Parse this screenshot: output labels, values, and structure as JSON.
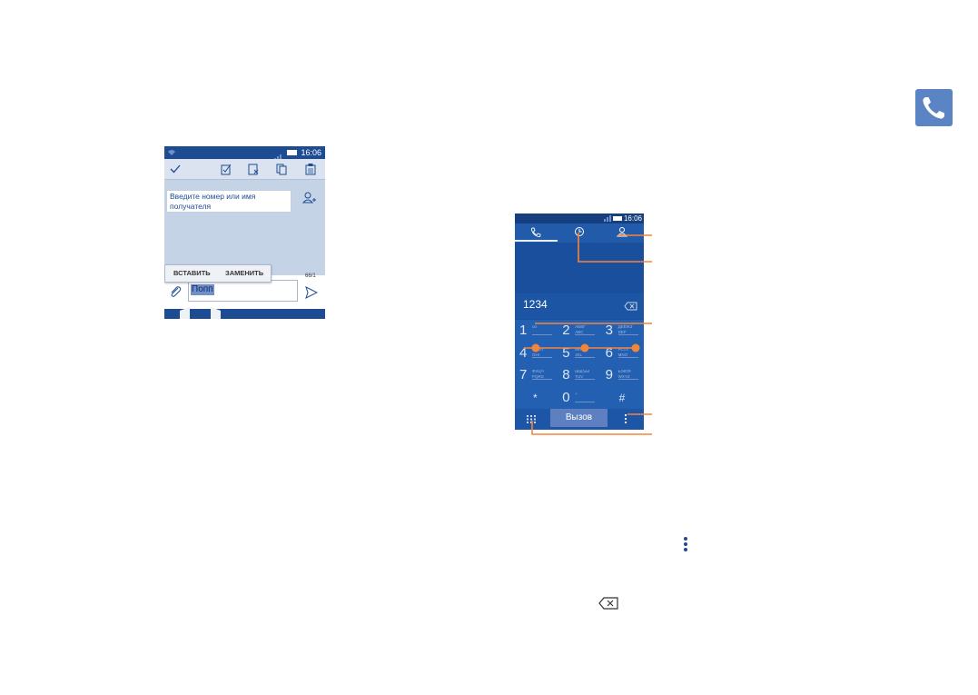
{
  "colors": {
    "accent": "#f4843c",
    "phone_blue": "#1a4f9e",
    "icon_badge": "#5b84c4"
  },
  "messaging_screen": {
    "status_time": "16:06",
    "recipient_placeholder": "Введите номер или имя получателя",
    "popup": {
      "paste_label": "ВСТАВИТЬ",
      "replace_label": "ЗАМЕНИТЬ"
    },
    "counter": "66/1",
    "selected_text": "Попп",
    "toolbar_icons": [
      "check-icon",
      "select-all-icon",
      "cut-icon",
      "copy-icon",
      "paste-icon"
    ]
  },
  "dialer_screen": {
    "status_time": "16:06",
    "tabs": [
      "phone-icon",
      "history-icon",
      "contacts-icon"
    ],
    "number": "1234",
    "keys": [
      {
        "d": "1",
        "l": "oo"
      },
      {
        "d": "2",
        "l": "АБВГ\nABC"
      },
      {
        "d": "3",
        "l": "ДЕЁЖЗ\nDEF"
      },
      {
        "d": "4",
        "l": "ИЙКЛ\nGHI"
      },
      {
        "d": "5",
        "l": "МНОП\nJKL"
      },
      {
        "d": "6",
        "l": "РСТУ\nMNO"
      },
      {
        "d": "7",
        "l": "ФХЦЧ\nPQRS"
      },
      {
        "d": "8",
        "l": "ШЩЪЫ\nTUV"
      },
      {
        "d": "9",
        "l": "ЬЭЮЯ\nWXYZ"
      },
      {
        "d": "*",
        "l": ""
      },
      {
        "d": "0",
        "l": "+"
      },
      {
        "d": "#",
        "l": ""
      }
    ],
    "call_label": "Вызов"
  }
}
